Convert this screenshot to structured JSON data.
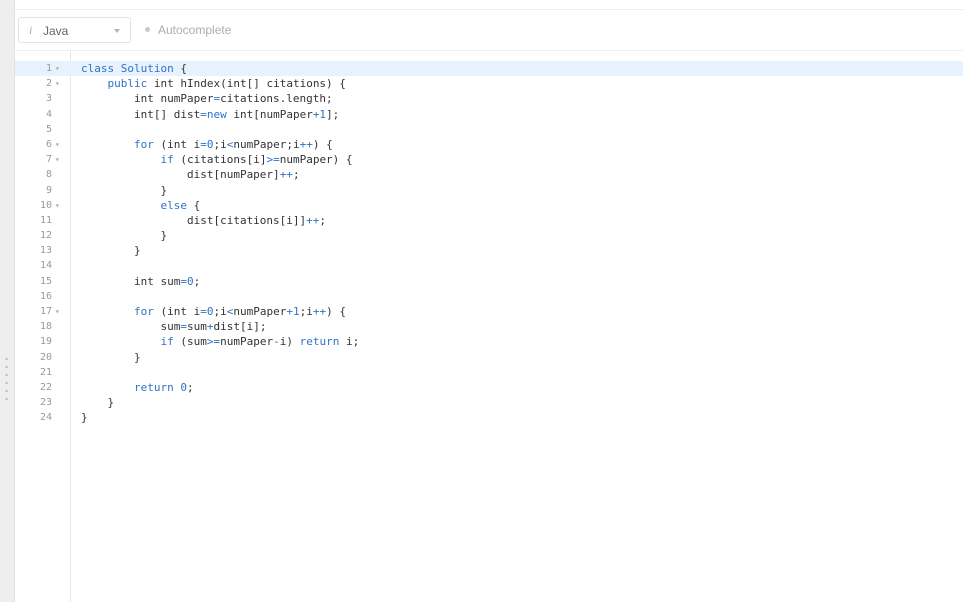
{
  "toolbar": {
    "language": "Java",
    "language_info_icon": "info-icon",
    "language_chevron_icon": "chevron-down-icon",
    "autocomplete_label": "Autocomplete",
    "autocomplete_status_icon": "status-dot-icon"
  },
  "editor": {
    "active_line": 1,
    "lines": [
      {
        "n": "1",
        "fold": true,
        "tokens": [
          {
            "t": "class Solution ",
            "c": "kw_mixed"
          },
          {
            "t": "{",
            "c": ""
          }
        ]
      },
      {
        "n": "2",
        "fold": true,
        "tokens": [
          {
            "t": "    ",
            "c": ""
          },
          {
            "t": "public",
            "c": "kw"
          },
          {
            "t": " int hIndex(int[] citations) {",
            "c": ""
          }
        ]
      },
      {
        "n": "3",
        "fold": false,
        "tokens": [
          {
            "t": "        int numPaper",
            "c": ""
          },
          {
            "t": "=",
            "c": "op"
          },
          {
            "t": "citations.length;",
            "c": ""
          }
        ]
      },
      {
        "n": "4",
        "fold": false,
        "tokens": [
          {
            "t": "        int[] dist",
            "c": ""
          },
          {
            "t": "=",
            "c": "op"
          },
          {
            "t": "new",
            "c": "kw"
          },
          {
            "t": " int[numPaper",
            "c": ""
          },
          {
            "t": "+1",
            "c": "op"
          },
          {
            "t": "];",
            "c": ""
          }
        ]
      },
      {
        "n": "5",
        "fold": false,
        "tokens": [
          {
            "t": "",
            "c": ""
          }
        ]
      },
      {
        "n": "6",
        "fold": true,
        "tokens": [
          {
            "t": "        ",
            "c": ""
          },
          {
            "t": "for",
            "c": "kw"
          },
          {
            "t": " (int i",
            "c": ""
          },
          {
            "t": "=0",
            "c": "op"
          },
          {
            "t": ";i",
            "c": ""
          },
          {
            "t": "<",
            "c": "op"
          },
          {
            "t": "numPaper;i",
            "c": ""
          },
          {
            "t": "++",
            "c": "op"
          },
          {
            "t": ") {",
            "c": ""
          }
        ]
      },
      {
        "n": "7",
        "fold": true,
        "tokens": [
          {
            "t": "            ",
            "c": ""
          },
          {
            "t": "if",
            "c": "kw"
          },
          {
            "t": " (citations[i]",
            "c": ""
          },
          {
            "t": ">=",
            "c": "op"
          },
          {
            "t": "numPaper) {",
            "c": ""
          }
        ]
      },
      {
        "n": "8",
        "fold": false,
        "tokens": [
          {
            "t": "                dist[numPaper]",
            "c": ""
          },
          {
            "t": "++",
            "c": "op"
          },
          {
            "t": ";",
            "c": ""
          }
        ]
      },
      {
        "n": "9",
        "fold": false,
        "tokens": [
          {
            "t": "            }",
            "c": ""
          }
        ]
      },
      {
        "n": "10",
        "fold": true,
        "tokens": [
          {
            "t": "            ",
            "c": ""
          },
          {
            "t": "else",
            "c": "kw"
          },
          {
            "t": " {",
            "c": ""
          }
        ]
      },
      {
        "n": "11",
        "fold": false,
        "tokens": [
          {
            "t": "                dist[citations[i]]",
            "c": ""
          },
          {
            "t": "++",
            "c": "op"
          },
          {
            "t": ";",
            "c": ""
          }
        ]
      },
      {
        "n": "12",
        "fold": false,
        "tokens": [
          {
            "t": "            }",
            "c": ""
          }
        ]
      },
      {
        "n": "13",
        "fold": false,
        "tokens": [
          {
            "t": "        }",
            "c": ""
          }
        ]
      },
      {
        "n": "14",
        "fold": false,
        "tokens": [
          {
            "t": "",
            "c": ""
          }
        ]
      },
      {
        "n": "15",
        "fold": false,
        "tokens": [
          {
            "t": "        int sum",
            "c": ""
          },
          {
            "t": "=0",
            "c": "op"
          },
          {
            "t": ";",
            "c": ""
          }
        ]
      },
      {
        "n": "16",
        "fold": false,
        "tokens": [
          {
            "t": "",
            "c": ""
          }
        ]
      },
      {
        "n": "17",
        "fold": true,
        "tokens": [
          {
            "t": "        ",
            "c": ""
          },
          {
            "t": "for",
            "c": "kw"
          },
          {
            "t": " (int i",
            "c": ""
          },
          {
            "t": "=0",
            "c": "op"
          },
          {
            "t": ";i",
            "c": ""
          },
          {
            "t": "<",
            "c": "op"
          },
          {
            "t": "numPaper",
            "c": ""
          },
          {
            "t": "+1",
            "c": "op"
          },
          {
            "t": ";i",
            "c": ""
          },
          {
            "t": "++",
            "c": "op"
          },
          {
            "t": ") {",
            "c": ""
          }
        ]
      },
      {
        "n": "18",
        "fold": false,
        "tokens": [
          {
            "t": "            sum",
            "c": ""
          },
          {
            "t": "=",
            "c": "op"
          },
          {
            "t": "sum",
            "c": ""
          },
          {
            "t": "+",
            "c": "op"
          },
          {
            "t": "dist[i];",
            "c": ""
          }
        ]
      },
      {
        "n": "19",
        "fold": false,
        "tokens": [
          {
            "t": "            ",
            "c": ""
          },
          {
            "t": "if",
            "c": "kw"
          },
          {
            "t": " (sum",
            "c": ""
          },
          {
            "t": ">=",
            "c": "op"
          },
          {
            "t": "numPaper",
            "c": ""
          },
          {
            "t": "-",
            "c": "op"
          },
          {
            "t": "i) ",
            "c": ""
          },
          {
            "t": "return",
            "c": "kw"
          },
          {
            "t": " i;",
            "c": ""
          }
        ]
      },
      {
        "n": "20",
        "fold": false,
        "tokens": [
          {
            "t": "        }",
            "c": ""
          }
        ]
      },
      {
        "n": "21",
        "fold": false,
        "tokens": [
          {
            "t": "",
            "c": ""
          }
        ]
      },
      {
        "n": "22",
        "fold": false,
        "tokens": [
          {
            "t": "        ",
            "c": ""
          },
          {
            "t": "return",
            "c": "kw"
          },
          {
            "t": " ",
            "c": ""
          },
          {
            "t": "0",
            "c": "num"
          },
          {
            "t": ";",
            "c": ""
          }
        ]
      },
      {
        "n": "23",
        "fold": false,
        "tokens": [
          {
            "t": "    }",
            "c": ""
          }
        ]
      },
      {
        "n": "24",
        "fold": false,
        "tokens": [
          {
            "t": "}",
            "c": ""
          }
        ]
      }
    ]
  },
  "colors": {
    "keyword": "#2f72c7",
    "active_line": "#e8f2ff",
    "line_number": "#999999"
  }
}
